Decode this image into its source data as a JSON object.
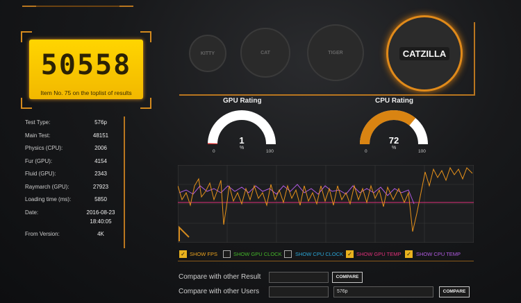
{
  "score": {
    "value": "50558",
    "subtitle": "Item No. 75 on the toplist of results"
  },
  "stats": [
    {
      "label": "Test Type:",
      "value": "576p"
    },
    {
      "label": "Main Test:",
      "value": "48151"
    },
    {
      "label": "Physics (CPU):",
      "value": "2006"
    },
    {
      "label": "Fur (GPU):",
      "value": "4154"
    },
    {
      "label": "Fluid (GPU):",
      "value": "2343"
    },
    {
      "label": "Raymarch (GPU):",
      "value": "27923"
    },
    {
      "label": "Loading time (ms):",
      "value": "5850"
    },
    {
      "label": "Date:",
      "value": "2016-08-23"
    },
    {
      "label": "",
      "value": "18:40:05"
    },
    {
      "label": "From Version:",
      "value": "4K"
    }
  ],
  "badges": [
    {
      "name": "KITTY"
    },
    {
      "name": "CAT"
    },
    {
      "name": "TIGER"
    },
    {
      "name": "CATZILLA"
    }
  ],
  "gauges": {
    "gpu": {
      "title": "GPU Rating",
      "value": "1",
      "unit": "%",
      "min": "0",
      "max": "100",
      "fraction": 0.01,
      "color": "#cc2222"
    },
    "cpu": {
      "title": "CPU Rating",
      "value": "72",
      "unit": "%",
      "min": "0",
      "max": "100",
      "fraction": 0.72,
      "color": "#d98412"
    }
  },
  "options": [
    {
      "label": "SHOW FPS",
      "checked": true,
      "color": "#e9a21e"
    },
    {
      "label": "SHOW GPU CLOCK",
      "checked": false,
      "color": "#44b82a"
    },
    {
      "label": "SHOW CPU CLOCK",
      "checked": false,
      "color": "#2aa6d8"
    },
    {
      "label": "SHOW GPU TEMP",
      "checked": true,
      "color": "#e0307a"
    },
    {
      "label": "SHOW CPU TEMP",
      "checked": true,
      "color": "#b05be0"
    }
  ],
  "compare": {
    "result_label": "Compare with other Result",
    "result_value": "",
    "result_button": "COMPARE",
    "users_label": "Compare with other Users",
    "users_value": "",
    "users_select": "576p",
    "users_button": "COMPARE"
  },
  "colors": {
    "accent": "#d48a1e",
    "score_bg": "#ffd500"
  }
}
